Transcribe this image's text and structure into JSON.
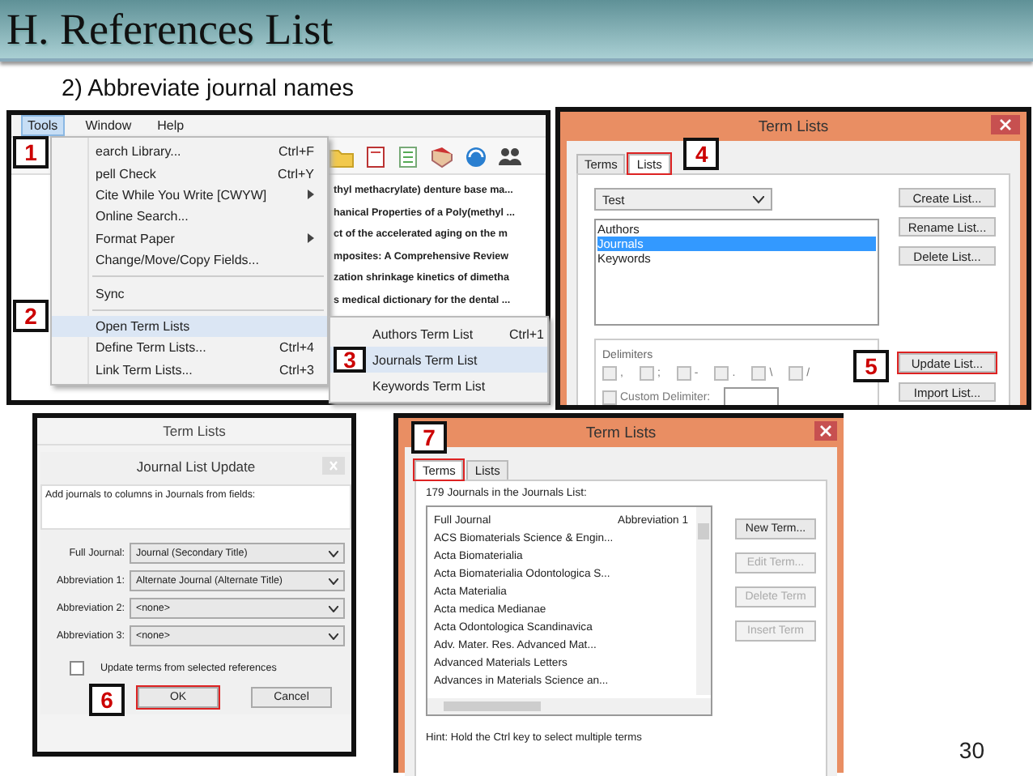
{
  "slide": {
    "title": "H. References List",
    "subtitle": "2) Abbreviate journal names",
    "page_number": "30"
  },
  "tools_menu_window": {
    "menubar": [
      {
        "label": "Tools",
        "selected": true
      },
      {
        "label": "Window",
        "selected": false
      },
      {
        "label": "Help",
        "selected": false
      }
    ],
    "reference_titles": [
      "thyl methacrylate) denture base ma...",
      "hanical Properties of a Poly(methyl ...",
      "ct of the accelerated aging on the m",
      "mposites: A Comprehensive Review",
      "zation shrinkage kinetics of dimetha",
      "s medical dictionary for the dental ..."
    ],
    "menu_items": [
      {
        "kind": "item",
        "label": "earch Library...",
        "shortcut": "Ctrl+F",
        "submenu": false,
        "selected": false,
        "step": "1"
      },
      {
        "kind": "item",
        "label": "pell Check",
        "shortcut": "Ctrl+Y",
        "submenu": false,
        "selected": false
      },
      {
        "kind": "item",
        "label": "Cite While You Write [CWYW]",
        "submenu": true,
        "selected": false
      },
      {
        "kind": "item",
        "label": "Online Search...",
        "submenu": false,
        "selected": false
      },
      {
        "kind": "item",
        "label": "Format Paper",
        "submenu": true,
        "selected": false
      },
      {
        "kind": "item",
        "label": "Change/Move/Copy Fields...",
        "submenu": false,
        "selected": false
      },
      {
        "kind": "separator"
      },
      {
        "kind": "item",
        "label": "Sync",
        "submenu": false,
        "selected": false
      },
      {
        "kind": "separator"
      },
      {
        "kind": "item",
        "label": "Open Term Lists",
        "submenu": false,
        "selected": true,
        "step": "2"
      },
      {
        "kind": "item",
        "label": "Define Term Lists...",
        "shortcut": "Ctrl+4",
        "submenu": false,
        "selected": false
      },
      {
        "kind": "item",
        "label": "Link Term Lists...",
        "shortcut": "Ctrl+3",
        "submenu": false,
        "selected": false
      }
    ],
    "submenu_items": [
      {
        "label": "Authors Term List",
        "shortcut": "Ctrl+1",
        "selected": false
      },
      {
        "label": "Journals Term List",
        "selected": true,
        "step": "3"
      },
      {
        "label": "Keywords Term List",
        "selected": false
      }
    ]
  },
  "lists_dialog": {
    "title": "Term Lists",
    "tabs": [
      {
        "label": "Terms",
        "selected": false,
        "highlighted": false
      },
      {
        "label": "Lists",
        "selected": true,
        "highlighted": true,
        "step": "4"
      }
    ],
    "list_dropdown": "Test",
    "lists": [
      {
        "label": "Authors",
        "selected": false
      },
      {
        "label": "Journals",
        "selected": true
      },
      {
        "label": "Keywords",
        "selected": false
      }
    ],
    "list_buttons": [
      {
        "label": "Create List...",
        "highlighted": false
      },
      {
        "label": "Rename List...",
        "highlighted": false
      },
      {
        "label": "Delete List...",
        "highlighted": false
      }
    ],
    "file_buttons": [
      {
        "label": "Update List...",
        "highlighted": true,
        "step": "5"
      },
      {
        "label": "Import List...",
        "highlighted": false
      }
    ],
    "delimiters_label": "Delimiters",
    "delimiters": [
      {
        "label": ",",
        "checked": false
      },
      {
        "label": ";",
        "checked": false
      },
      {
        "label": "-",
        "checked": false
      },
      {
        "label": ".",
        "checked": false
      },
      {
        "label": "\\",
        "checked": false
      },
      {
        "label": "/",
        "checked": false
      }
    ],
    "custom_delimiter": {
      "label": "Custom Delimiter:",
      "checked": false
    }
  },
  "update_dialog": {
    "parent_title": "Term Lists",
    "title": "Journal List Update",
    "instruction": "Add journals to columns in Journals from fields:",
    "fields": [
      {
        "label": "Full Journal:",
        "value": "Journal (Secondary Title)"
      },
      {
        "label": "Abbreviation 1:",
        "value": "Alternate Journal (Alternate Title)"
      },
      {
        "label": "Abbreviation 2:",
        "value": "<none>"
      },
      {
        "label": "Abbreviation 3:",
        "value": "<none>"
      }
    ],
    "update_option": {
      "label": "Update terms from selected references",
      "checked": false
    },
    "buttons": [
      {
        "label": "OK",
        "highlighted": true,
        "step": "6"
      },
      {
        "label": "Cancel",
        "highlighted": false
      }
    ]
  },
  "terms_dialog": {
    "title": "Term Lists",
    "tabs": [
      {
        "label": "Terms",
        "selected": true,
        "highlighted": true,
        "step": "7"
      },
      {
        "label": "Lists",
        "selected": false,
        "highlighted": false
      }
    ],
    "count_label": "179 Journals in the Journals List:",
    "columns": [
      "Full Journal",
      "Abbreviation 1"
    ],
    "rows": [
      "ACS Biomaterials Science & Engin...",
      "Acta Biomaterialia",
      "Acta Biomaterialia Odontologica S...",
      "Acta Materialia",
      "Acta medica Medianae",
      "Acta Odontologica Scandinavica",
      "Adv. Mater. Res. Advanced Mat...",
      "Advanced Materials Letters",
      "Advances in Materials Science an..."
    ],
    "buttons": [
      {
        "label": "New Term...",
        "disabled": false
      },
      {
        "label": "Edit Term...",
        "disabled": true
      },
      {
        "label": "Delete Term",
        "disabled": true
      },
      {
        "label": "Insert Term",
        "disabled": true
      }
    ],
    "hint": "Hint: Hold the Ctrl key to select multiple terms"
  }
}
